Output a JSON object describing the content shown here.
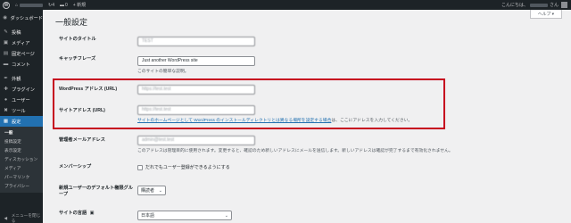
{
  "adminbar": {
    "logo_glyph": "W",
    "updates_icon": "refresh-icon",
    "updates_count": "4",
    "comments_icon": "comment-icon",
    "comments_count": "0",
    "new_label": "+ 新規",
    "greeting_prefix": "こんにちは、",
    "greeting_suffix": "さん"
  },
  "sidebar": {
    "items": [
      {
        "icon": "dashboard-icon",
        "glyph": "◉",
        "label": "ダッシュボード"
      },
      {
        "icon": "pin-icon",
        "glyph": "✎",
        "label": "投稿"
      },
      {
        "icon": "media-icon",
        "glyph": "▣",
        "label": "メディア"
      },
      {
        "icon": "page-icon",
        "glyph": "▤",
        "label": "固定ページ"
      },
      {
        "icon": "comment-icon",
        "glyph": "▬",
        "label": "コメント"
      },
      {
        "icon": "appearance-icon",
        "glyph": "✒",
        "label": "外観"
      },
      {
        "icon": "plugin-icon",
        "glyph": "✚",
        "label": "プラグイン"
      },
      {
        "icon": "users-icon",
        "glyph": "●",
        "label": "ユーザー"
      },
      {
        "icon": "tools-icon",
        "glyph": "✖",
        "label": "ツール"
      },
      {
        "icon": "settings-icon",
        "glyph": "▦",
        "label": "設定"
      }
    ],
    "submenu": [
      "一般",
      "投稿設定",
      "表示設定",
      "ディスカッション",
      "メディア",
      "パーマリンク",
      "プライバシー"
    ],
    "collapse_label": "メニューを閉じる"
  },
  "main": {
    "help_label": "ヘルプ ▾",
    "title": "一般設定",
    "site_title": {
      "label": "サイトのタイトル",
      "value": "TEST"
    },
    "tagline": {
      "label": "キャッチフレーズ",
      "value": "Just another WordPress site",
      "desc": "このサイトの簡単な説明。"
    },
    "wp_address": {
      "label": "WordPress アドレス (URL)",
      "value": "https://test.test"
    },
    "site_address": {
      "label": "サイトアドレス (URL)",
      "value": "https://test.test",
      "desc_link": "サイトのホームページとして WordPress のインストールディレクトリとは異なる場所を設定する場合",
      "desc_tail": "は、ここにアドレスを入力してください。"
    },
    "admin_email": {
      "label": "管理者メールアドレス",
      "value": "admin@test.test",
      "desc": "このアドレスは管理目的に使用されます。変更すると、確認のため新しいアドレスにメールを送信します。新しいアドレスは確認が完了するまで有効化されません。"
    },
    "membership": {
      "label": "メンバーシップ",
      "checkbox_label": "だれでもユーザー登録ができるようにする"
    },
    "default_role": {
      "label": "新規ユーザーのデフォルト権限グループ",
      "value": "購読者"
    },
    "language": {
      "label": "サイトの言語",
      "value": "日本語",
      "icon": "translation-icon"
    }
  },
  "colors": {
    "accent": "#2271b1",
    "highlight": "#c6001e",
    "sidebar_bg": "#1d2327"
  }
}
